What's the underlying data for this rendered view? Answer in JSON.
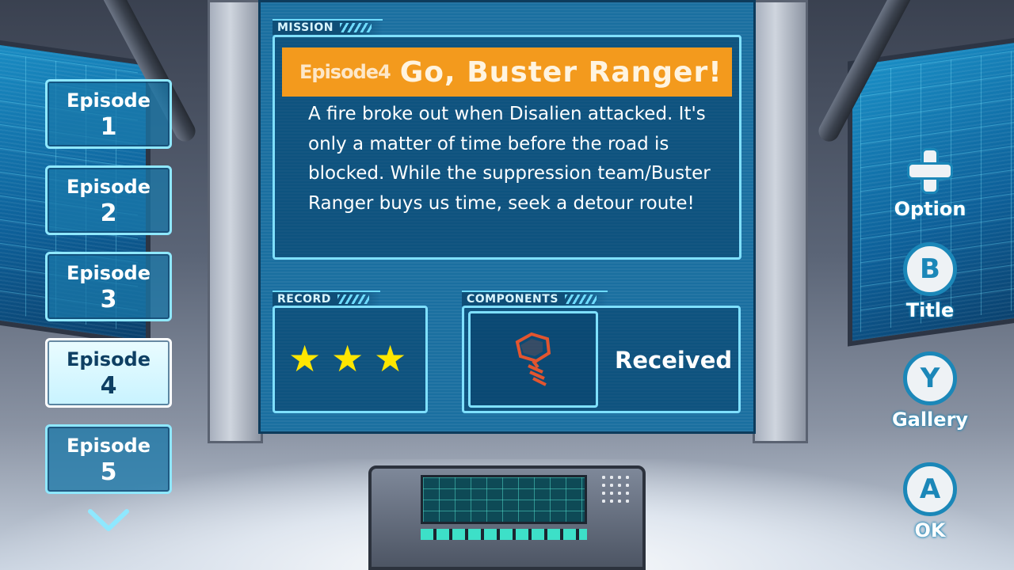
{
  "mission": {
    "section_label": "MISSION",
    "episode_tag": "Episode4",
    "title": "Go, Buster Ranger!",
    "description": "A fire broke out when Disalien attacked. It's only a matter of time before the road is blocked. While the suppression team/Buster Ranger buys us time, seek a detour route!"
  },
  "record": {
    "section_label": "RECORD",
    "stars_earned": 3,
    "stars_total": 3,
    "star_glyph": "★",
    "star_color": "#ffe600"
  },
  "components": {
    "section_label": "COMPONENTS",
    "item_icon": "bolt-icon",
    "status": "Received"
  },
  "episodes": [
    {
      "label": "Episode",
      "number": "1"
    },
    {
      "label": "Episode",
      "number": "2"
    },
    {
      "label": "Episode",
      "number": "3"
    },
    {
      "label": "Episode",
      "number": "4"
    },
    {
      "label": "Episode",
      "number": "5"
    }
  ],
  "selected_episode": "4",
  "controls": {
    "option": {
      "glyph": "+",
      "label": "Option"
    },
    "title": {
      "glyph": "B",
      "label": "Title"
    },
    "gallery": {
      "glyph": "Y",
      "label": "Gallery"
    },
    "ok": {
      "glyph": "A",
      "label": "OK"
    }
  },
  "colors": {
    "title_bar": "#f39a1d",
    "panel": "#1a6fa0",
    "accent": "#7fe0ff"
  }
}
